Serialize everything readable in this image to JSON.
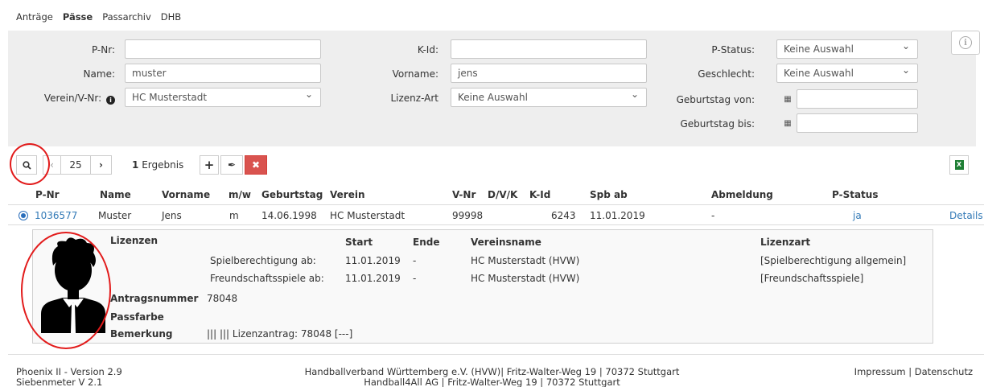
{
  "nav": {
    "items": [
      "Anträge",
      "Pässe",
      "Passarchiv",
      "DHB"
    ],
    "active": "Pässe"
  },
  "filter": {
    "pnr_label": "P-Nr:",
    "pnr_value": "",
    "name_label": "Name:",
    "name_value": "muster",
    "verein_label": "Verein/V-Nr:",
    "verein_value": "HC Musterstadt",
    "kid_label": "K-Id:",
    "kid_value": "",
    "vorname_label": "Vorname:",
    "vorname_value": "jens",
    "lizenzart_label": "Lizenz-Art",
    "lizenzart_value": "Keine Auswahl",
    "pstatus_label": "P-Status:",
    "pstatus_value": "Keine Auswahl",
    "geschlecht_label": "Geschlecht:",
    "geschlecht_value": "Keine Auswahl",
    "geb_von_label": "Geburtstag von:",
    "geb_von_value": "",
    "geb_bis_label": "Geburtstag bis:",
    "geb_bis_value": ""
  },
  "toolbar": {
    "page_size": "25",
    "result_count": "1",
    "result_label": "Ergebnis"
  },
  "table": {
    "headers": [
      "P-Nr",
      "Name",
      "Vorname",
      "m/w",
      "Geburtstag",
      "Verein",
      "V-Nr",
      "D/V/K",
      "K-Id",
      "Spb ab",
      "Abmeldung",
      "P-Status"
    ],
    "row": {
      "pnr": "1036577",
      "name": "Muster",
      "vorname": "Jens",
      "mw": "m",
      "geburtstag": "14.06.1998",
      "verein": "HC Musterstadt",
      "vnr": "99998",
      "dvk": "",
      "kid": "6243",
      "spb_ab": "11.01.2019",
      "abmeldung": "-",
      "pstatus": "ja",
      "details": "Details"
    }
  },
  "detail": {
    "lizenzen_label": "Lizenzen",
    "col_start": "Start",
    "col_ende": "Ende",
    "col_vereinsname": "Vereinsname",
    "col_lizenzart": "Lizenzart",
    "licenses": [
      {
        "label": "Spielberechtigung ab:",
        "start": "11.01.2019",
        "ende": "-",
        "verein": "HC Musterstadt (HVW)",
        "art": "[Spielberechtigung allgemein]"
      },
      {
        "label": "Freundschaftsspiele ab:",
        "start": "11.01.2019",
        "ende": "-",
        "verein": "HC Musterstadt (HVW)",
        "art": "[Freundschaftsspiele]"
      }
    ],
    "antragsnummer_label": "Antragsnummer",
    "antragsnummer_value": "78048",
    "passfarbe_label": "Passfarbe",
    "passfarbe_value": "",
    "bemerkung_label": "Bemerkung",
    "bemerkung_value": "||| ||| Lizenzantrag: 78048 [---]"
  },
  "footer": {
    "version": "Phoenix II - Version 2.9",
    "siebenmeter": "Siebenmeter V 2.1",
    "address1": "Handballverband Württemberg e.V. (HVW)| Fritz-Walter-Weg 19 | 70372 Stuttgart",
    "address2": "Handball4All AG | Fritz-Walter-Weg 19 | 70372 Stuttgart",
    "impressum": "Impressum",
    "separator": "|",
    "datenschutz": "Datenschutz"
  },
  "colors": {
    "link": "#337ab7",
    "danger": "#d9534f",
    "excel": "#1e7e34",
    "highlight_circle": "#e21b1b"
  }
}
